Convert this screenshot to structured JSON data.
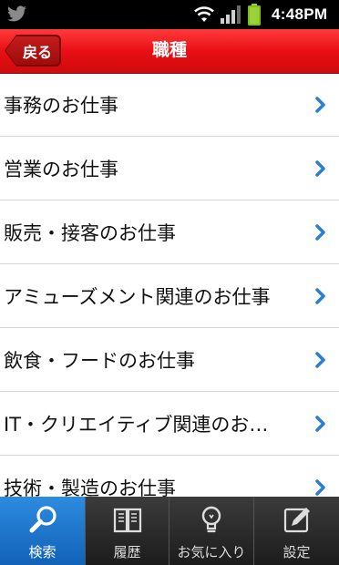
{
  "status_bar": {
    "time": "4:48PM",
    "icons": [
      "twitter-bird-icon",
      "wifi-icon",
      "signal-icon",
      "battery-icon"
    ]
  },
  "header": {
    "back_label": "戻る",
    "title": "職種",
    "color": "#e80f14"
  },
  "job_categories": [
    {
      "label": "事務のお仕事"
    },
    {
      "label": "営業のお仕事"
    },
    {
      "label": "販売・接客のお仕事"
    },
    {
      "label": "アミューズメント関連のお仕事"
    },
    {
      "label": "飲食・フードのお仕事"
    },
    {
      "label": "IT・クリエイティブ関連のお…"
    },
    {
      "label": "技術・製造のお仕事"
    }
  ],
  "chevron_color": "#2e7fd0",
  "tabs": [
    {
      "label": "検索",
      "icon": "search-icon",
      "active": true
    },
    {
      "label": "履歴",
      "icon": "book-icon",
      "active": false
    },
    {
      "label": "お気に入り",
      "icon": "lightbulb-icon",
      "active": false
    },
    {
      "label": "設定",
      "icon": "edit-icon",
      "active": false
    }
  ]
}
